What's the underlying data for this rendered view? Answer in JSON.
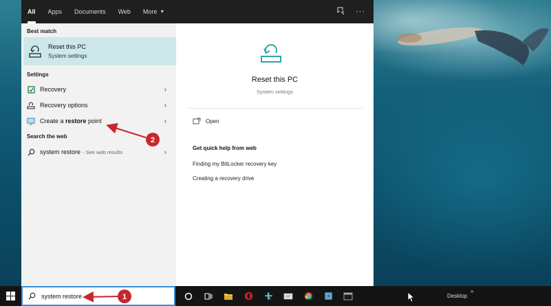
{
  "topbar": {
    "tabs": [
      {
        "label": "All",
        "active": true
      },
      {
        "label": "Apps"
      },
      {
        "label": "Documents"
      },
      {
        "label": "Web"
      },
      {
        "label": "More"
      }
    ]
  },
  "results": {
    "best_match_label": "Best match",
    "best_match": {
      "title": "Reset this PC",
      "subtitle": "System settings",
      "icon": "reset-pc-icon"
    },
    "settings_label": "Settings",
    "settings_items": [
      {
        "label": "Recovery",
        "icon": "recovery-icon"
      },
      {
        "label": "Recovery options",
        "icon": "recovery-options-icon"
      },
      {
        "label_pre": "Create a ",
        "label_bold": "restore",
        "label_post": " point",
        "icon": "monitor-icon"
      }
    ],
    "web_label": "Search the web",
    "web_item": {
      "label": "system restore",
      "sub": "- See web results",
      "icon": "search-icon"
    }
  },
  "preview": {
    "title": "Reset this PC",
    "subtitle": "System settings",
    "open_label": "Open",
    "quick_help": "Get quick help from web",
    "links": [
      "Finding my BitLocker recovery key",
      "Creating a recovery drive"
    ]
  },
  "taskbar": {
    "search_value": "system restore",
    "desktop_label": "Desktop",
    "overflow": "»"
  },
  "annotations": {
    "marker_1": "1",
    "marker_2": "2",
    "color": "#c8262e"
  },
  "colors": {
    "accent_highlight": "#cde8ea",
    "search_border": "#3a8fd6",
    "dark": "#1f1f1f"
  }
}
